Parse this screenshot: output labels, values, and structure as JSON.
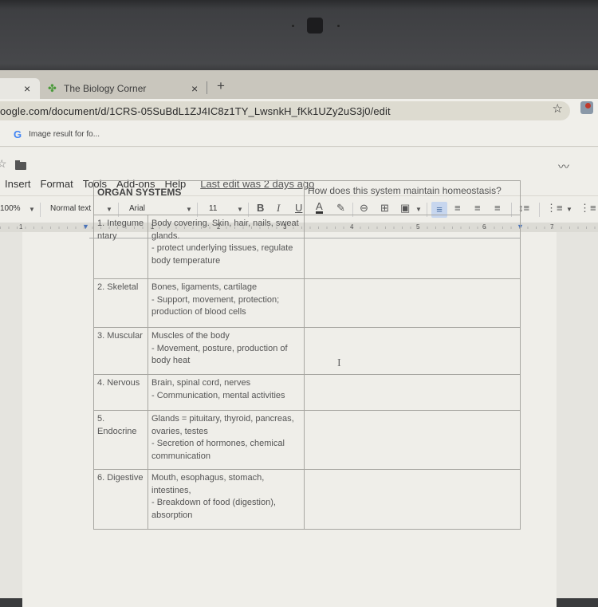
{
  "browser": {
    "tabs": [
      {
        "label": "",
        "active": true,
        "close_icon": "×"
      },
      {
        "label": "The Biology Corner",
        "active": false,
        "close_icon": "×"
      }
    ],
    "new_tab_label": "+",
    "url": "oogle.com/document/d/1CRS-05SuBdL1ZJ4IC8z1TY_LwsnkH_fKk1UZy2uS3j0/edit",
    "bookmark_star": "☆",
    "bookmarks": [
      {
        "icon": "G",
        "label": "Image result for fo..."
      }
    ]
  },
  "docs": {
    "menu": [
      "Insert",
      "Format",
      "Tools",
      "Add-ons",
      "Help"
    ],
    "last_edit": "Last edit was 2 days ago",
    "toolbar": {
      "zoom": "100%",
      "style": "Normal text",
      "font": "Arial",
      "size": "11",
      "bold": "B",
      "italic": "I",
      "underline": "U",
      "text_color": "A",
      "highlight": "✎",
      "link": "⊖",
      "comment": "⊞",
      "image": "▣",
      "align_left": "≡",
      "align_center": "≡",
      "align_right": "≡",
      "justify": "≡",
      "line_spacing": "↕≡",
      "numbered_list": "⋮≡",
      "bulleted_list": "⋮≡"
    },
    "ruler_labels": [
      "1",
      "1",
      "2",
      "3",
      "4",
      "5",
      "6",
      "7"
    ]
  },
  "table": {
    "header": {
      "left": "ORGAN SYSTEMS",
      "right": "How does this system maintain homeostasis?"
    },
    "rows": [
      {
        "name": "1. Integume ntary",
        "description": "Body covering. Skin, hair, nails, sweat glands.\n- protect underlying tissues, regulate body temperature",
        "answer": ""
      },
      {
        "name": "2. Skeletal",
        "description": "Bones, ligaments, cartilage\n - Support, movement, protection; production of blood cells",
        "answer": ""
      },
      {
        "name": "3. Muscular",
        "description": "Muscles of the body\n- Movement, posture, production of body heat",
        "answer": ""
      },
      {
        "name": "4. Nervous",
        "description": "Brain, spinal cord, nerves\n- Communication, mental activities",
        "answer": ""
      },
      {
        "name": "5. Endocrine",
        "description": "Glands = pituitary, thyroid, pancreas, ovaries, testes\n- Secretion of hormones, chemical communication",
        "answer": ""
      },
      {
        "name": "6. Digestive",
        "description": "Mouth, esophagus, stomach, intestines,\n- Breakdown of food (digestion), absorption",
        "answer": ""
      }
    ]
  },
  "cursor": "I"
}
